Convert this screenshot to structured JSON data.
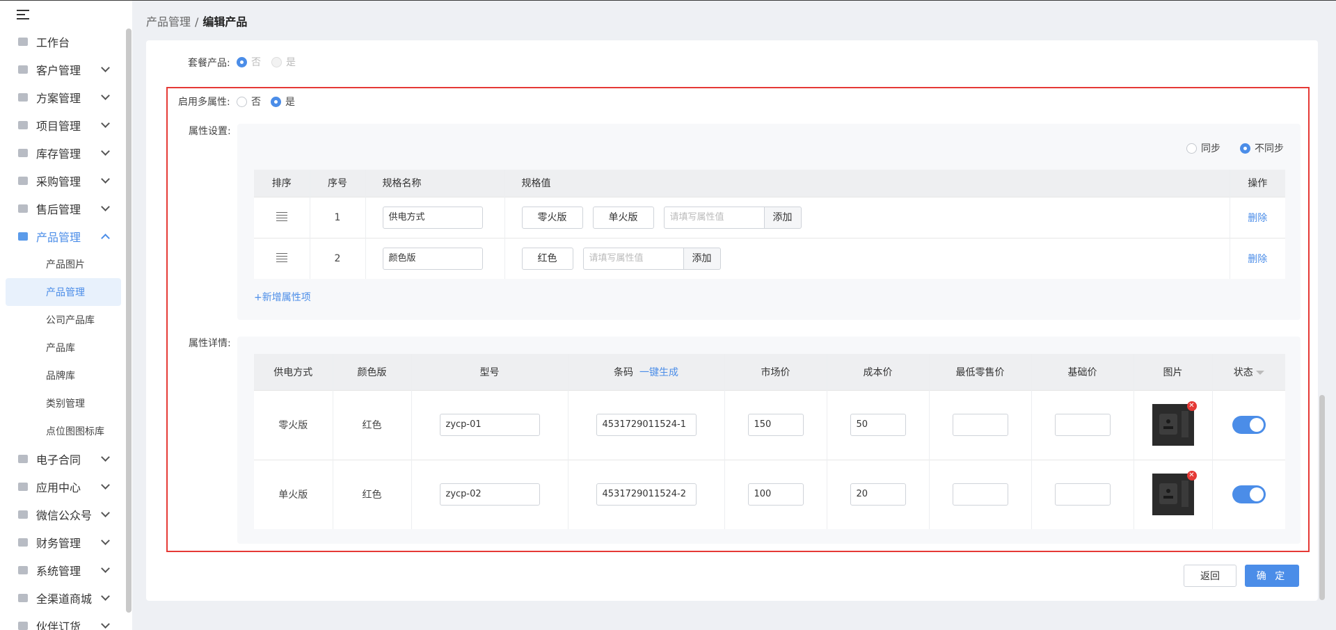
{
  "sidebar": {
    "items": [
      {
        "label": "工作台",
        "icon": "home-icon"
      },
      {
        "label": "客户管理",
        "icon": "customer-icon"
      },
      {
        "label": "方案管理",
        "icon": "plan-icon"
      },
      {
        "label": "项目管理",
        "icon": "folder-icon"
      },
      {
        "label": "库存管理",
        "icon": "inventory-icon"
      },
      {
        "label": "采购管理",
        "icon": "cart-icon"
      },
      {
        "label": "售后管理",
        "icon": "headset-icon"
      },
      {
        "label": "产品管理",
        "icon": "product-icon"
      },
      {
        "label": "电子合同",
        "icon": "contract-icon"
      },
      {
        "label": "应用中心",
        "icon": "apps-icon"
      },
      {
        "label": "微信公众号",
        "icon": "wechat-icon"
      },
      {
        "label": "财务管理",
        "icon": "finance-icon"
      },
      {
        "label": "系统管理",
        "icon": "system-icon"
      },
      {
        "label": "全渠道商城",
        "icon": "mall-icon"
      },
      {
        "label": "伙伴订货",
        "icon": "partner-icon"
      }
    ],
    "sub_items": [
      "产品图片",
      "产品管理",
      "公司产品库",
      "产品库",
      "品牌库",
      "类别管理",
      "点位图图标库"
    ]
  },
  "breadcrumb": {
    "parent": "产品管理",
    "separator": "/",
    "current": "编辑产品"
  },
  "form": {
    "package_label": "套餐产品:",
    "package_no": "否",
    "package_yes": "是",
    "multi_label": "启用多属性:",
    "multi_no": "否",
    "multi_yes": "是",
    "attr_settings_label": "属性设置:",
    "attr_detail_label": "属性详情:",
    "sync": "同步",
    "not_sync": "不同步",
    "add_attr": "+新增属性项"
  },
  "spec_table": {
    "headers": [
      "排序",
      "序号",
      "规格名称",
      "规格值",
      "操作"
    ],
    "rows": [
      {
        "index": "1",
        "name": "供电方式",
        "values": [
          "零火版",
          "单火版"
        ],
        "placeholder": "请填写属性值",
        "add": "添加",
        "action": "删除"
      },
      {
        "index": "2",
        "name": "颜色版",
        "values": [
          "红色"
        ],
        "placeholder": "请填写属性值",
        "add": "添加",
        "action": "删除"
      }
    ]
  },
  "detail_table": {
    "headers": [
      "供电方式",
      "颜色版",
      "型号",
      "条码",
      "市场价",
      "成本价",
      "最低零售价",
      "基础价",
      "图片",
      "状态"
    ],
    "generate_link": "一键生成",
    "rows": [
      {
        "power": "零火版",
        "color": "红色",
        "model": "zycp-01",
        "barcode": "4531729011524-1",
        "market": "150",
        "cost": "50",
        "min_retail": "",
        "base": "",
        "status": "on"
      },
      {
        "power": "单火版",
        "color": "红色",
        "model": "zycp-02",
        "barcode": "4531729011524-2",
        "market": "100",
        "cost": "20",
        "min_retail": "",
        "base": "",
        "status": "on"
      }
    ]
  },
  "buttons": {
    "back": "返回",
    "confirm": "确 定"
  },
  "colors": {
    "accent": "#4b8de8",
    "highlight_border": "#e53935"
  }
}
